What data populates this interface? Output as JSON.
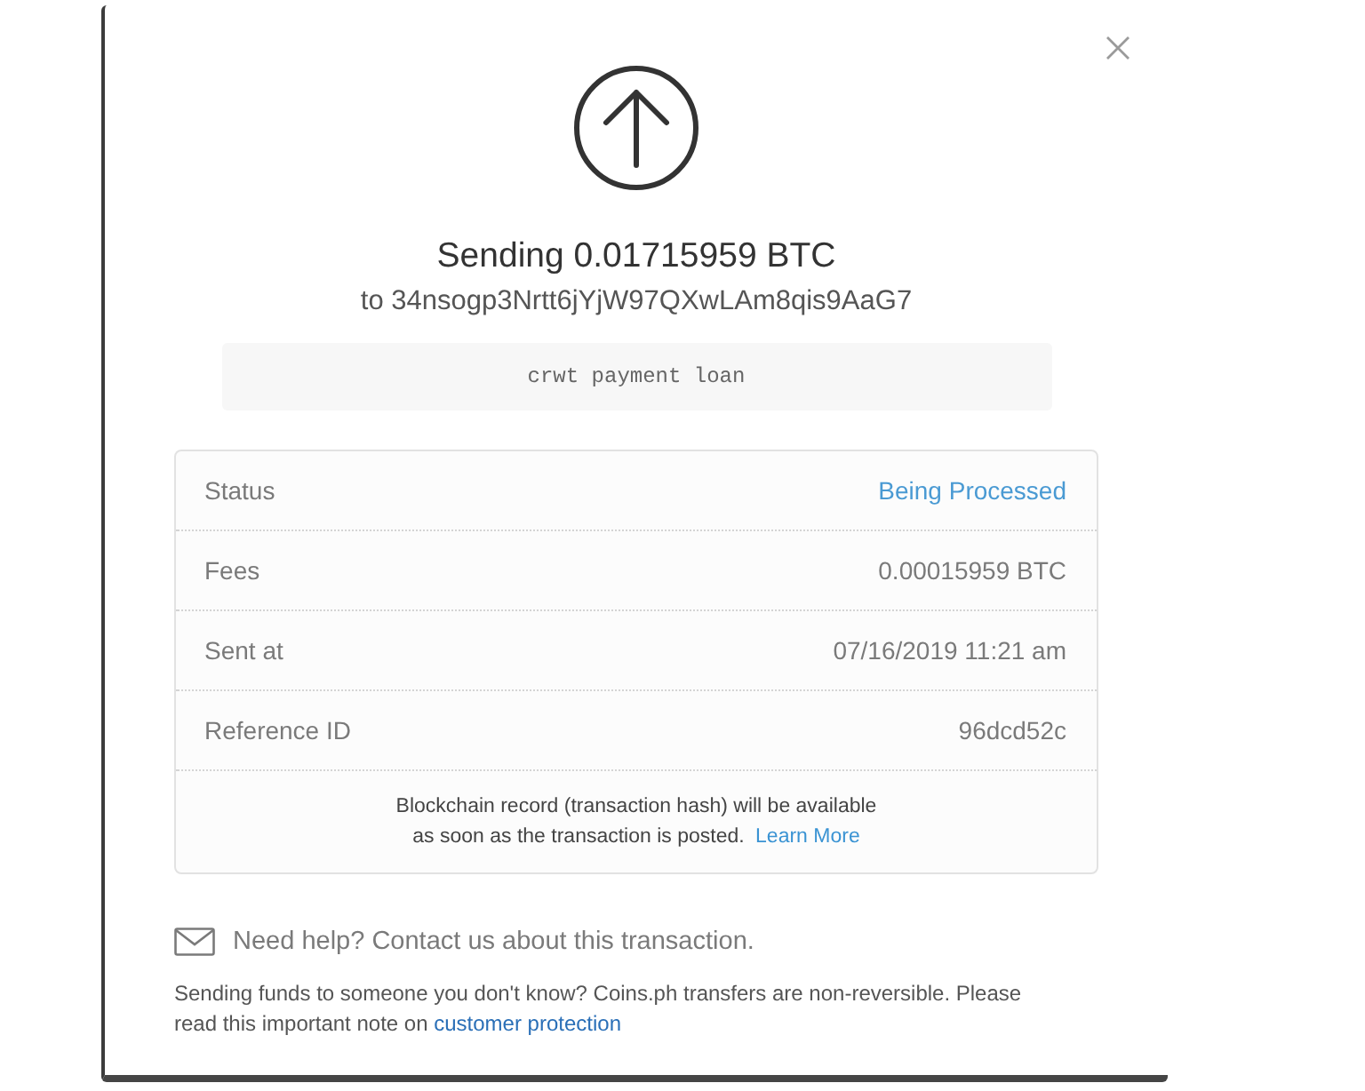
{
  "dialog": {
    "title": "Sending 0.01715959 BTC",
    "recipient": "to 34nsogp3Nrtt6jYjW97QXwLAm8qis9AaG7",
    "memo": "crwt payment loan"
  },
  "details": {
    "rows": [
      {
        "kind": "status",
        "label": "Status",
        "value": "Being Processed"
      },
      {
        "kind": "plain",
        "label": "Fees",
        "value": "0.00015959 BTC"
      },
      {
        "kind": "plain",
        "label": "Sent at",
        "value": "07/16/2019 11:21 am"
      },
      {
        "kind": "plain",
        "label": "Reference ID",
        "value": "96dcd52c"
      }
    ],
    "note": "Blockchain record (transaction hash) will be available as soon as the transaction is posted.",
    "note_link": "Learn More"
  },
  "help": "Need help? Contact us about this transaction.",
  "warning": {
    "text": "Sending funds to someone you don't know? Coins.ph transfers are non-reversible. Please read this important note on",
    "link": "customer protection"
  }
}
